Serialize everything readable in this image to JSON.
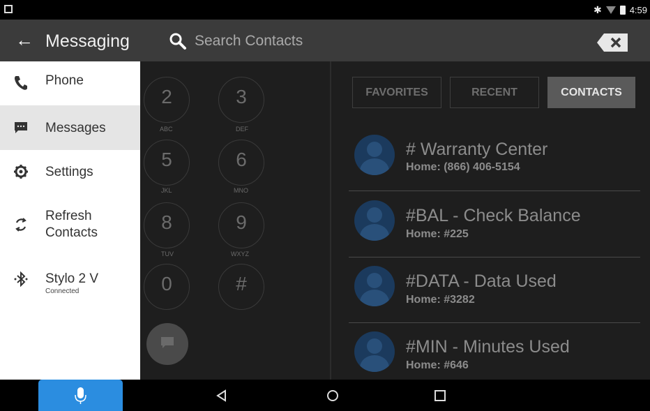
{
  "status_bar": {
    "time": "4:59"
  },
  "header": {
    "title": "Messaging",
    "search_placeholder": "Search Contacts"
  },
  "drawer": {
    "items": [
      {
        "label": "Phone",
        "icon": "phone-icon"
      },
      {
        "label": "Messages",
        "icon": "message-icon"
      },
      {
        "label": "Settings",
        "icon": "gear-icon"
      },
      {
        "label": "Refresh Contacts",
        "icon": "refresh-icon"
      },
      {
        "label": "Stylo 2 V",
        "sub": "Connected",
        "icon": "bluetooth-icon"
      }
    ]
  },
  "dialer": {
    "keys": [
      {
        "digit": "2",
        "letters": "ABC"
      },
      {
        "digit": "3",
        "letters": "DEF"
      },
      {
        "digit": "5",
        "letters": "JKL"
      },
      {
        "digit": "6",
        "letters": "MNO"
      },
      {
        "digit": "8",
        "letters": "TUV"
      },
      {
        "digit": "9",
        "letters": "WXYZ"
      },
      {
        "digit": "0",
        "letters": ""
      },
      {
        "digit": "#",
        "letters": ""
      }
    ]
  },
  "tabs": [
    {
      "label": "FAVORITES",
      "active": false
    },
    {
      "label": "RECENT",
      "active": false
    },
    {
      "label": "CONTACTS",
      "active": true
    }
  ],
  "contacts": [
    {
      "name": "# Warranty Center",
      "phone": "Home: (866) 406-5154"
    },
    {
      "name": "#BAL - Check Balance",
      "phone": "Home: #225"
    },
    {
      "name": "#DATA - Data Used",
      "phone": "Home: #3282"
    },
    {
      "name": "#MIN - Minutes Used",
      "phone": "Home: #646"
    }
  ],
  "colors": {
    "accent": "#2b8de0",
    "action_bar": "#3b3b3b",
    "avatar": "#1b3a5d"
  }
}
